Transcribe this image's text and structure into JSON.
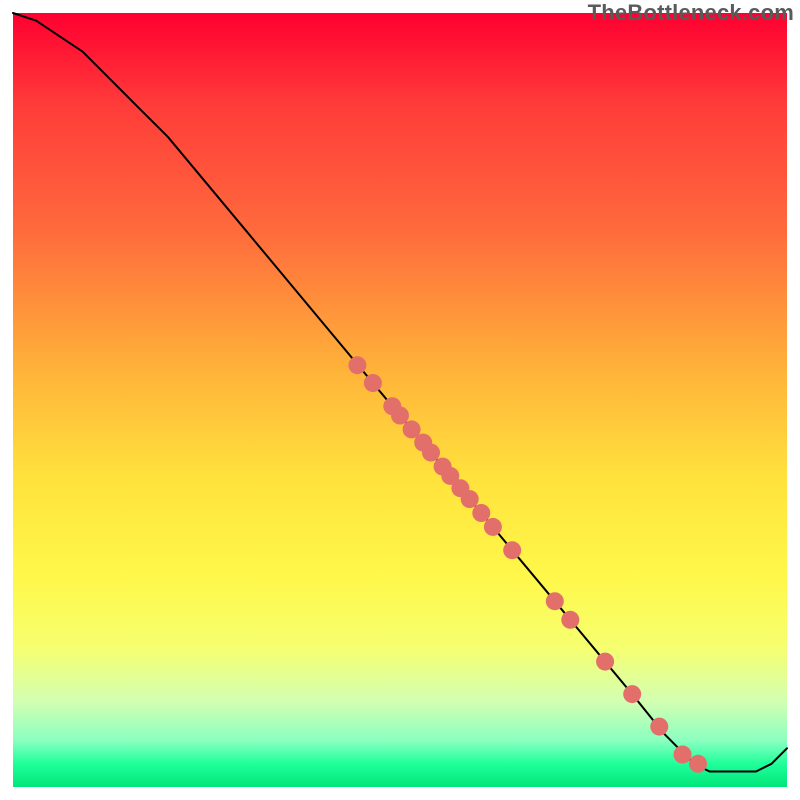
{
  "watermark": "TheBottleneck.com",
  "chart_data": {
    "type": "line",
    "title": "",
    "xlabel": "",
    "ylabel": "",
    "xlim": [
      0,
      100
    ],
    "ylim": [
      0,
      100
    ],
    "grid": false,
    "legend": false,
    "background_gradient": {
      "top": "#ff0030",
      "mid_upper": "#ffb23a",
      "mid": "#fff84a",
      "mid_lower": "#d2ffb2",
      "bottom": "#00e67a"
    },
    "series": [
      {
        "name": "curve",
        "type": "line",
        "color": "#000000",
        "stroke_width": 2,
        "x": [
          0,
          3,
          6,
          9,
          12,
          16,
          20,
          30,
          40,
          50,
          55,
          60,
          65,
          70,
          75,
          80,
          84,
          86,
          88,
          90,
          94,
          96,
          98,
          100
        ],
        "y": [
          100,
          99,
          97,
          95,
          92,
          88,
          84,
          72,
          60,
          48,
          42,
          36,
          30,
          24,
          18,
          12,
          7,
          5,
          3,
          2,
          2,
          2,
          3,
          5
        ]
      },
      {
        "name": "points",
        "type": "scatter",
        "color": "#e36f6a",
        "radius": 9,
        "x": [
          44.5,
          46.5,
          49.0,
          50.0,
          51.5,
          53.0,
          54.0,
          55.5,
          56.5,
          57.8,
          59.0,
          60.5,
          62.0,
          64.5,
          70.0,
          72.0,
          76.5,
          80.0,
          83.5,
          86.5,
          88.5
        ],
        "y": [
          54.5,
          52.2,
          49.2,
          48.0,
          46.2,
          44.5,
          43.2,
          41.4,
          40.2,
          38.6,
          37.2,
          35.4,
          33.6,
          30.6,
          24.0,
          21.6,
          16.2,
          12.0,
          7.8,
          4.2,
          3.0
        ]
      }
    ]
  }
}
